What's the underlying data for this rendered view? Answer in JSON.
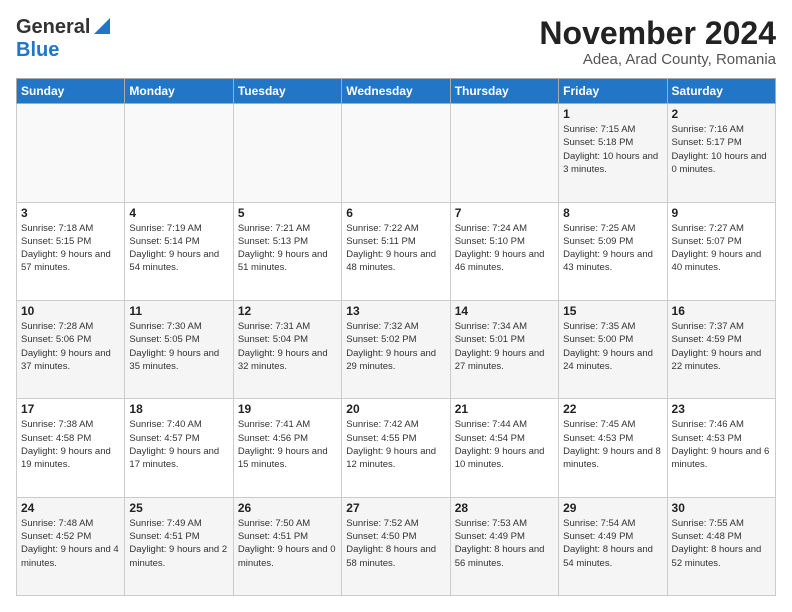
{
  "header": {
    "logo_general": "General",
    "logo_blue": "Blue",
    "month_year": "November 2024",
    "location": "Adea, Arad County, Romania"
  },
  "days_of_week": [
    "Sunday",
    "Monday",
    "Tuesday",
    "Wednesday",
    "Thursday",
    "Friday",
    "Saturday"
  ],
  "weeks": [
    [
      {
        "day": "",
        "empty": true
      },
      {
        "day": "",
        "empty": true
      },
      {
        "day": "",
        "empty": true
      },
      {
        "day": "",
        "empty": true
      },
      {
        "day": "",
        "empty": true
      },
      {
        "day": "1",
        "sunrise": "Sunrise: 7:15 AM",
        "sunset": "Sunset: 5:18 PM",
        "daylight": "Daylight: 10 hours and 3 minutes."
      },
      {
        "day": "2",
        "sunrise": "Sunrise: 7:16 AM",
        "sunset": "Sunset: 5:17 PM",
        "daylight": "Daylight: 10 hours and 0 minutes."
      }
    ],
    [
      {
        "day": "3",
        "sunrise": "Sunrise: 7:18 AM",
        "sunset": "Sunset: 5:15 PM",
        "daylight": "Daylight: 9 hours and 57 minutes."
      },
      {
        "day": "4",
        "sunrise": "Sunrise: 7:19 AM",
        "sunset": "Sunset: 5:14 PM",
        "daylight": "Daylight: 9 hours and 54 minutes."
      },
      {
        "day": "5",
        "sunrise": "Sunrise: 7:21 AM",
        "sunset": "Sunset: 5:13 PM",
        "daylight": "Daylight: 9 hours and 51 minutes."
      },
      {
        "day": "6",
        "sunrise": "Sunrise: 7:22 AM",
        "sunset": "Sunset: 5:11 PM",
        "daylight": "Daylight: 9 hours and 48 minutes."
      },
      {
        "day": "7",
        "sunrise": "Sunrise: 7:24 AM",
        "sunset": "Sunset: 5:10 PM",
        "daylight": "Daylight: 9 hours and 46 minutes."
      },
      {
        "day": "8",
        "sunrise": "Sunrise: 7:25 AM",
        "sunset": "Sunset: 5:09 PM",
        "daylight": "Daylight: 9 hours and 43 minutes."
      },
      {
        "day": "9",
        "sunrise": "Sunrise: 7:27 AM",
        "sunset": "Sunset: 5:07 PM",
        "daylight": "Daylight: 9 hours and 40 minutes."
      }
    ],
    [
      {
        "day": "10",
        "sunrise": "Sunrise: 7:28 AM",
        "sunset": "Sunset: 5:06 PM",
        "daylight": "Daylight: 9 hours and 37 minutes."
      },
      {
        "day": "11",
        "sunrise": "Sunrise: 7:30 AM",
        "sunset": "Sunset: 5:05 PM",
        "daylight": "Daylight: 9 hours and 35 minutes."
      },
      {
        "day": "12",
        "sunrise": "Sunrise: 7:31 AM",
        "sunset": "Sunset: 5:04 PM",
        "daylight": "Daylight: 9 hours and 32 minutes."
      },
      {
        "day": "13",
        "sunrise": "Sunrise: 7:32 AM",
        "sunset": "Sunset: 5:02 PM",
        "daylight": "Daylight: 9 hours and 29 minutes."
      },
      {
        "day": "14",
        "sunrise": "Sunrise: 7:34 AM",
        "sunset": "Sunset: 5:01 PM",
        "daylight": "Daylight: 9 hours and 27 minutes."
      },
      {
        "day": "15",
        "sunrise": "Sunrise: 7:35 AM",
        "sunset": "Sunset: 5:00 PM",
        "daylight": "Daylight: 9 hours and 24 minutes."
      },
      {
        "day": "16",
        "sunrise": "Sunrise: 7:37 AM",
        "sunset": "Sunset: 4:59 PM",
        "daylight": "Daylight: 9 hours and 22 minutes."
      }
    ],
    [
      {
        "day": "17",
        "sunrise": "Sunrise: 7:38 AM",
        "sunset": "Sunset: 4:58 PM",
        "daylight": "Daylight: 9 hours and 19 minutes."
      },
      {
        "day": "18",
        "sunrise": "Sunrise: 7:40 AM",
        "sunset": "Sunset: 4:57 PM",
        "daylight": "Daylight: 9 hours and 17 minutes."
      },
      {
        "day": "19",
        "sunrise": "Sunrise: 7:41 AM",
        "sunset": "Sunset: 4:56 PM",
        "daylight": "Daylight: 9 hours and 15 minutes."
      },
      {
        "day": "20",
        "sunrise": "Sunrise: 7:42 AM",
        "sunset": "Sunset: 4:55 PM",
        "daylight": "Daylight: 9 hours and 12 minutes."
      },
      {
        "day": "21",
        "sunrise": "Sunrise: 7:44 AM",
        "sunset": "Sunset: 4:54 PM",
        "daylight": "Daylight: 9 hours and 10 minutes."
      },
      {
        "day": "22",
        "sunrise": "Sunrise: 7:45 AM",
        "sunset": "Sunset: 4:53 PM",
        "daylight": "Daylight: 9 hours and 8 minutes."
      },
      {
        "day": "23",
        "sunrise": "Sunrise: 7:46 AM",
        "sunset": "Sunset: 4:53 PM",
        "daylight": "Daylight: 9 hours and 6 minutes."
      }
    ],
    [
      {
        "day": "24",
        "sunrise": "Sunrise: 7:48 AM",
        "sunset": "Sunset: 4:52 PM",
        "daylight": "Daylight: 9 hours and 4 minutes."
      },
      {
        "day": "25",
        "sunrise": "Sunrise: 7:49 AM",
        "sunset": "Sunset: 4:51 PM",
        "daylight": "Daylight: 9 hours and 2 minutes."
      },
      {
        "day": "26",
        "sunrise": "Sunrise: 7:50 AM",
        "sunset": "Sunset: 4:51 PM",
        "daylight": "Daylight: 9 hours and 0 minutes."
      },
      {
        "day": "27",
        "sunrise": "Sunrise: 7:52 AM",
        "sunset": "Sunset: 4:50 PM",
        "daylight": "Daylight: 8 hours and 58 minutes."
      },
      {
        "day": "28",
        "sunrise": "Sunrise: 7:53 AM",
        "sunset": "Sunset: 4:49 PM",
        "daylight": "Daylight: 8 hours and 56 minutes."
      },
      {
        "day": "29",
        "sunrise": "Sunrise: 7:54 AM",
        "sunset": "Sunset: 4:49 PM",
        "daylight": "Daylight: 8 hours and 54 minutes."
      },
      {
        "day": "30",
        "sunrise": "Sunrise: 7:55 AM",
        "sunset": "Sunset: 4:48 PM",
        "daylight": "Daylight: 8 hours and 52 minutes."
      }
    ]
  ]
}
